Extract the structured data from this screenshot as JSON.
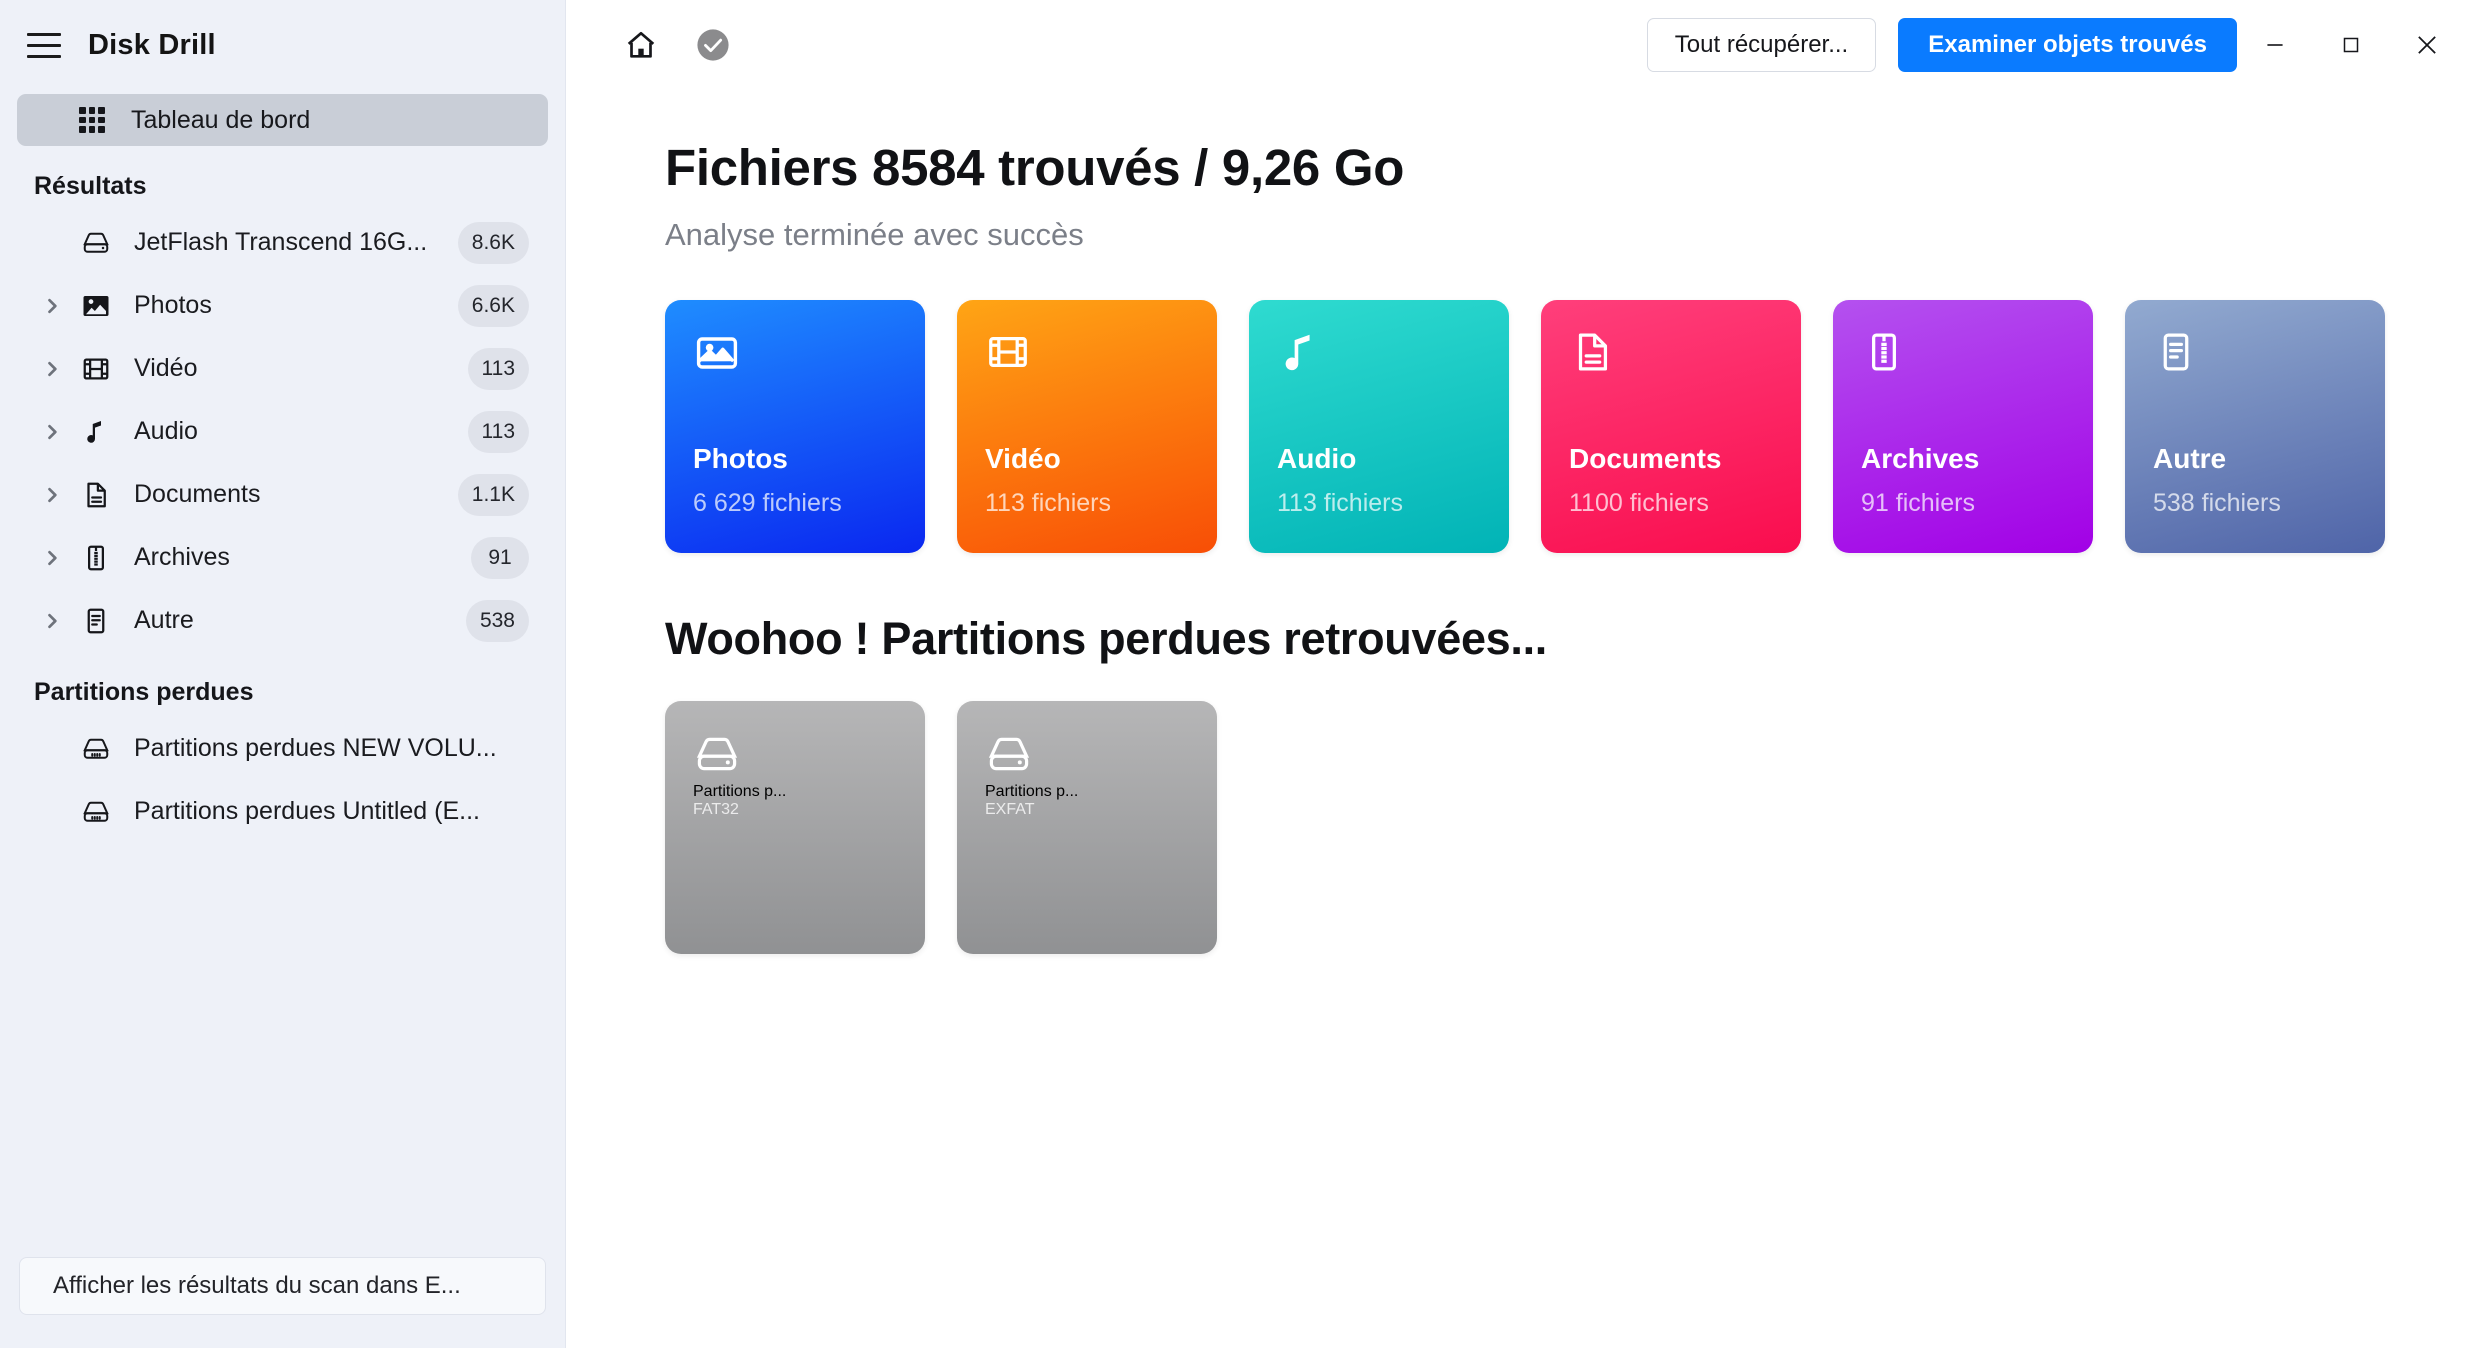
{
  "app": {
    "title": "Disk Drill"
  },
  "sidebar": {
    "dashboard": {
      "label": "Tableau de bord",
      "icon": "grid-icon"
    },
    "results_group": "Résultats",
    "results": [
      {
        "label": "JetFlash Transcend 16G...",
        "badge": "8.6K",
        "icon": "disk-icon",
        "expandable": false
      },
      {
        "label": "Photos",
        "badge": "6.6K",
        "icon": "image-icon",
        "expandable": true
      },
      {
        "label": "Vidéo",
        "badge": "113",
        "icon": "film-icon",
        "expandable": true
      },
      {
        "label": "Audio",
        "badge": "113",
        "icon": "music-icon",
        "expandable": true
      },
      {
        "label": "Documents",
        "badge": "1.1K",
        "icon": "document-icon",
        "expandable": true
      },
      {
        "label": "Archives",
        "badge": "91",
        "icon": "archive-icon",
        "expandable": true
      },
      {
        "label": "Autre",
        "badge": "538",
        "icon": "file-icon",
        "expandable": true
      }
    ],
    "partitions_group": "Partitions perdues",
    "partitions": [
      {
        "label": "Partitions perdues NEW VOLU...",
        "icon": "drive-icon"
      },
      {
        "label": "Partitions perdues Untitled (E...",
        "icon": "drive-icon"
      }
    ],
    "footer_button": "Afficher les résultats du scan dans E..."
  },
  "toolbar": {
    "home_icon": "home-icon",
    "status_icon": "check-circle-icon",
    "recover_all_label": "Tout récupérer...",
    "review_found_label": "Examiner objets trouvés",
    "minimize_icon": "minimize-icon",
    "maximize_icon": "maximize-icon",
    "close_icon": "close-icon",
    "primary_color": "#0a7bff"
  },
  "main": {
    "page_title": "Fichiers 8584 trouvés / 9,26 Go",
    "page_subtitle": "Analyse terminée avec succès",
    "section_title": "Woohoo ! Partitions perdues retrouvées...",
    "categories": [
      {
        "title": "Photos",
        "count": "6 629 fichiers",
        "icon": "image-icon",
        "color_from": "#1f8dff",
        "color_to": "#0a27f0"
      },
      {
        "title": "Vidéo",
        "count": "113 fichiers",
        "icon": "film-icon",
        "color_from": "#ffa515",
        "color_to": "#f84e06"
      },
      {
        "title": "Audio",
        "count": "113 fichiers",
        "icon": "music-icon",
        "color_from": "#2fdbd0",
        "color_to": "#01b3b6"
      },
      {
        "title": "Documents",
        "count": "1100 fichiers",
        "icon": "document-icon",
        "color_from": "#ff3f7b",
        "color_to": "#f90d4e"
      },
      {
        "title": "Archives",
        "count": "91 fichiers",
        "icon": "archive-icon",
        "color_from": "#b451ef",
        "color_to": "#a200e6"
      },
      {
        "title": "Autre",
        "count": "538 fichiers",
        "icon": "file-icon",
        "color_from": "#92aad0",
        "color_to": "#4f64a8"
      }
    ],
    "partition_cards": [
      {
        "title": "Partitions p...",
        "format": "FAT32",
        "icon": "drive-icon"
      },
      {
        "title": "Partitions p...",
        "format": "EXFAT",
        "icon": "drive-icon"
      }
    ]
  }
}
